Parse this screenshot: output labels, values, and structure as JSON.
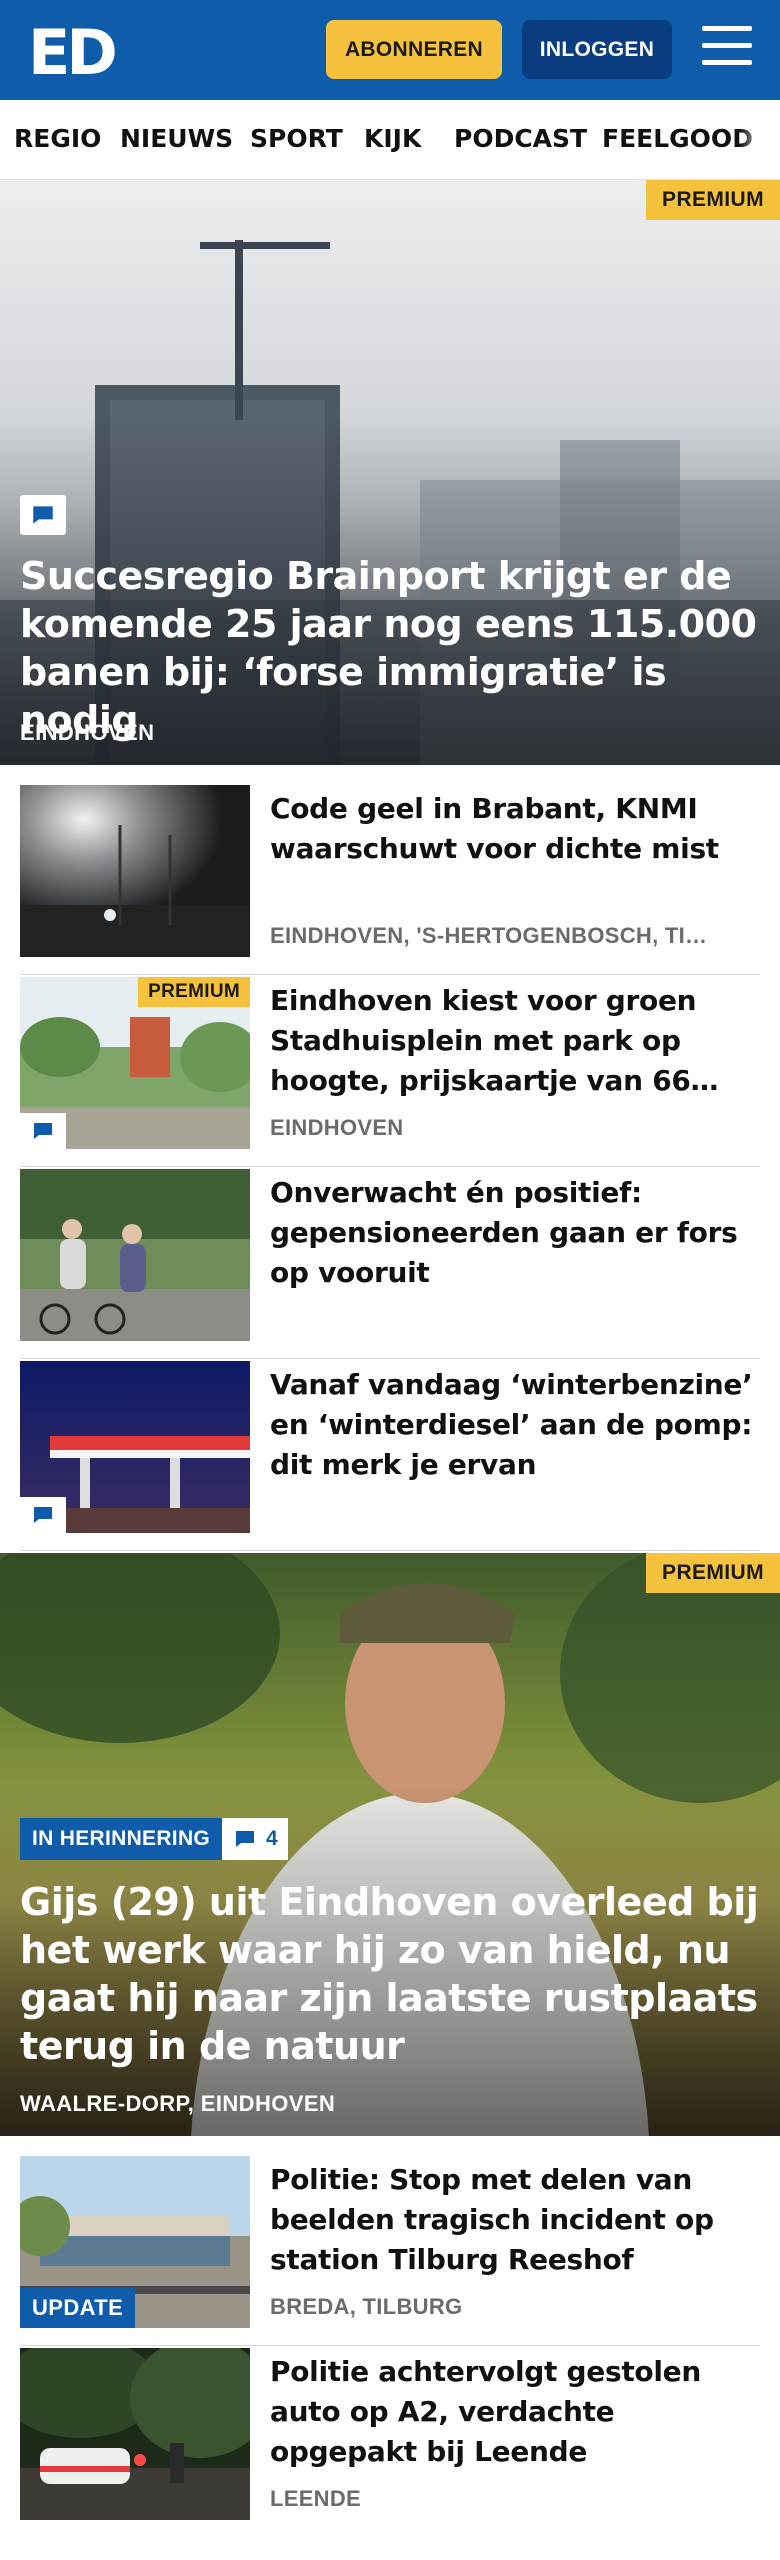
{
  "header": {
    "logo_text": "ED",
    "subscribe_label": "ABONNEREN",
    "login_label": "INLOGGEN",
    "brand_color": "#0f5cab",
    "accent_color": "#f6c23e"
  },
  "nav": {
    "items": [
      "REGIO",
      "NIEUWS",
      "SPORT",
      "KIJK",
      "PODCAST",
      "FEELGOOD",
      "I"
    ]
  },
  "hero1": {
    "badge": "PREMIUM",
    "title": "Succesregio Brainport krijgt er de komende 25 jaar nog eens 115.000 banen bij: ‘forse immigratie’ is nodig",
    "location": "EINDHOVEN",
    "icon": "comment-icon"
  },
  "articles": [
    {
      "title": "Code geel in Brabant, KNMI waarschuwt voor dichte mist",
      "location": "EINDHOVEN, 'S-HERTOGENBOSCH, TI…"
    },
    {
      "title": "Eindhoven kiest voor groen Stadhuisplein met park op hoogte, prijskaartje van 66…",
      "location": "EINDHOVEN",
      "badge": "PREMIUM"
    },
    {
      "title": "Onverwacht én positief: gepensioneerden gaan er fors op vooruit",
      "location": ""
    },
    {
      "title": "Vanaf vandaag ‘winterbenzine’ en ‘winterdiesel’ aan de pomp: dit merk je ervan",
      "location": ""
    }
  ],
  "hero2": {
    "badge": "PREMIUM",
    "tag": "IN HERINNERING",
    "comment_count": "4",
    "title": "Gijs (29) uit Eindhoven overleed bij het werk waar hij zo van hield, nu gaat hij naar zijn laatste rustplaats terug in de natuur",
    "location": "WAALRE-DORP, EINDHOVEN"
  },
  "articles2": [
    {
      "title": "Politie: Stop met delen van beelden tragisch incident op station Tilburg Reeshof",
      "location": "BREDA, TILBURG",
      "tag": "UPDATE"
    },
    {
      "title": "Politie achtervolgt gestolen auto op A2, verdachte opgepakt bij Leende",
      "location": "LEENDE"
    }
  ]
}
